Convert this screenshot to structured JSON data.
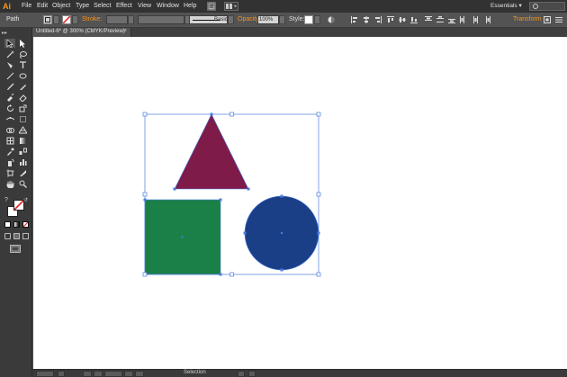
{
  "app": {
    "logo": "Ai"
  },
  "menu": [
    "File",
    "Edit",
    "Object",
    "Type",
    "Select",
    "Effect",
    "View",
    "Window",
    "Help"
  ],
  "workspace": {
    "label": "Essentials",
    "arrow": "▾"
  },
  "control_bar": {
    "selection_label": "Path",
    "stroke_label": "Stroke:",
    "brush_label": "Basic",
    "opacity_label": "Opacity:",
    "opacity_value": "100%",
    "style_label": "Style:",
    "transform_label": "Transform"
  },
  "document": {
    "tab_title": "Untitled-6* @ 300% (CMYK/Preview)",
    "close_glyph": "×"
  },
  "status": {
    "text": "Selection"
  },
  "colors": {
    "triangle": "#7f1b48",
    "square": "#1a8047",
    "circle": "#1b3f87",
    "selection": "#4a7de0",
    "accent": "#f7931e"
  },
  "icons": {
    "tools": [
      "selection-tool-icon",
      "direct-selection-tool-icon",
      "magic-wand-tool-icon",
      "lasso-tool-icon",
      "pen-tool-icon",
      "type-tool-icon",
      "line-segment-tool-icon",
      "ellipse-tool-icon",
      "paintbrush-tool-icon",
      "pencil-tool-icon",
      "blob-brush-tool-icon",
      "eraser-tool-icon",
      "rotate-tool-icon",
      "scale-tool-icon",
      "width-tool-icon",
      "free-transform-tool-icon",
      "shape-builder-tool-icon",
      "perspective-grid-tool-icon",
      "mesh-tool-icon",
      "gradient-tool-icon",
      "eyedropper-tool-icon",
      "blend-tool-icon",
      "symbol-sprayer-tool-icon",
      "column-graph-tool-icon",
      "artboard-tool-icon",
      "slice-tool-icon",
      "hand-tool-icon",
      "zoom-tool-icon"
    ]
  }
}
